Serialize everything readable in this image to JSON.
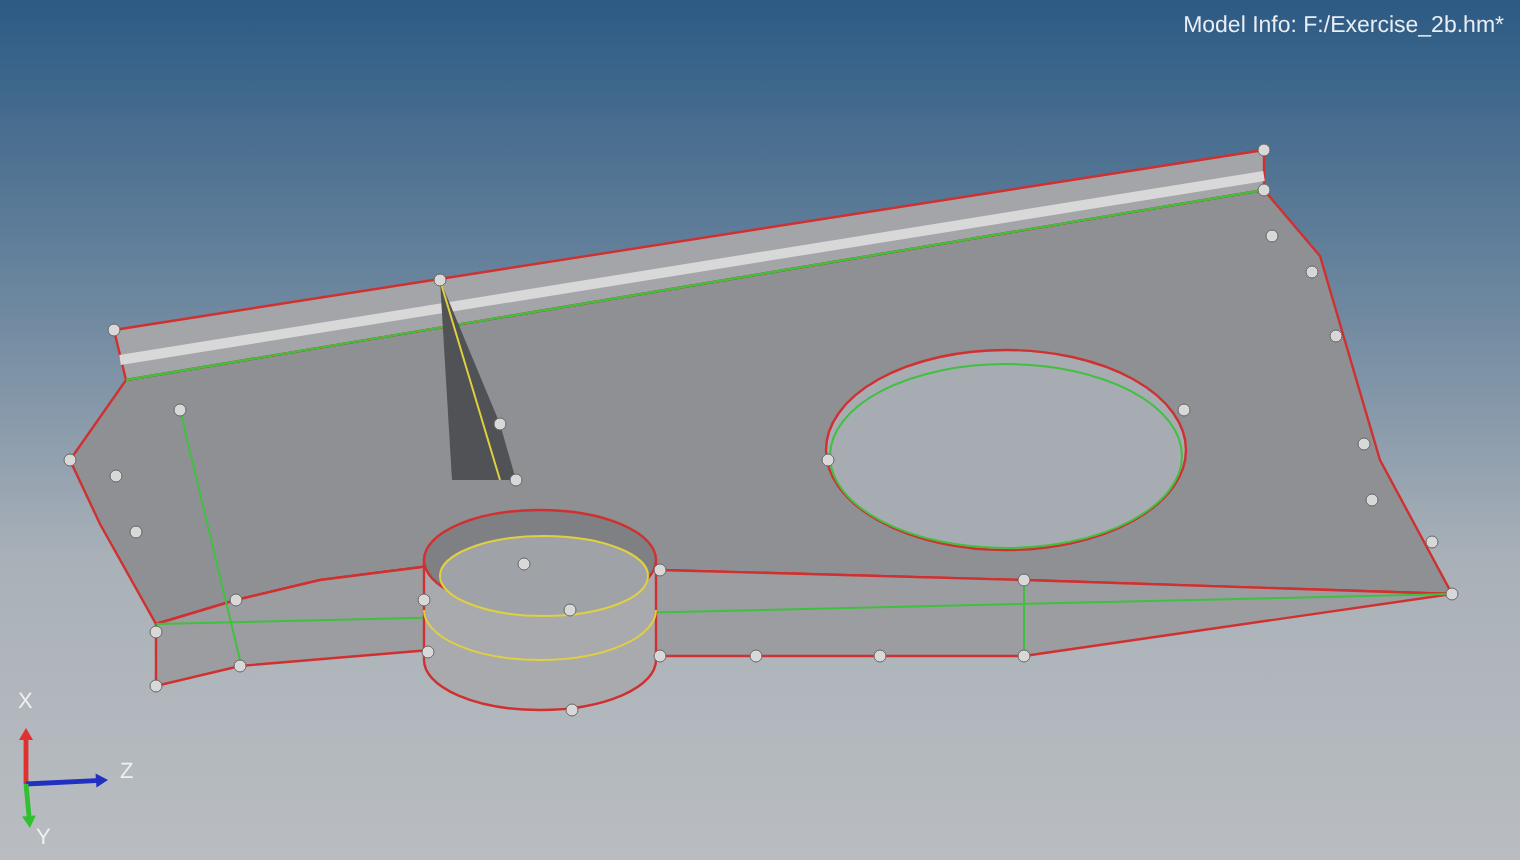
{
  "model_info": "Model Info: F:/Exercise_2b.hm*",
  "axes": [
    {
      "label": "X",
      "color": "#e03030"
    },
    {
      "label": "Z",
      "color": "#2030c0"
    },
    {
      "label": "Y",
      "color": "#30c030"
    }
  ]
}
